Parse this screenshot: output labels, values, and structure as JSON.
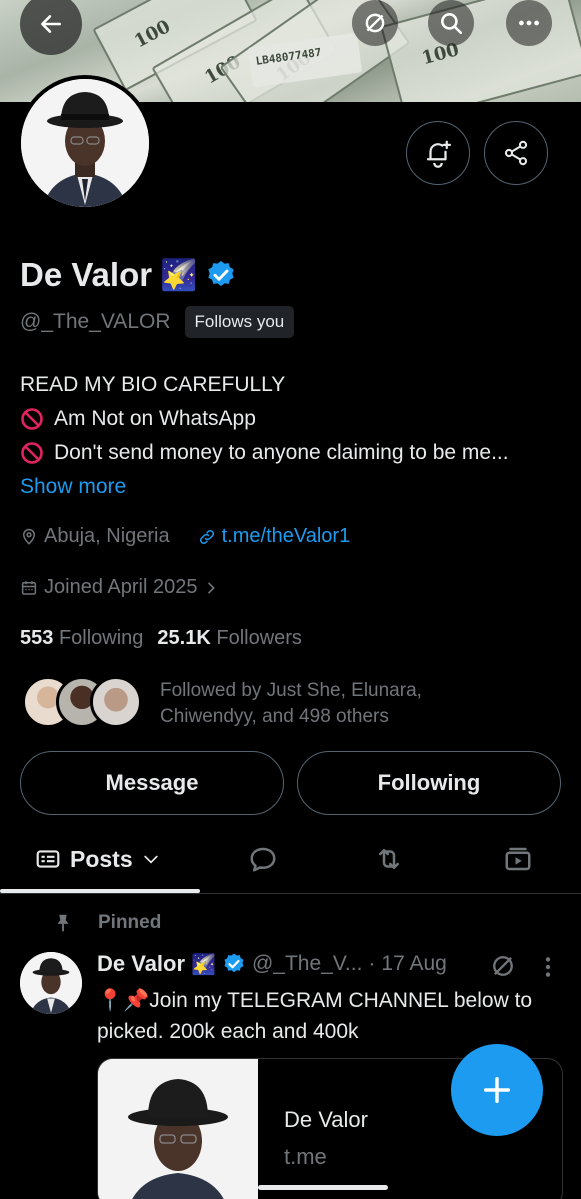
{
  "banner": {
    "bill_text": [
      "100",
      "100",
      "100",
      "LB48077487",
      "100"
    ]
  },
  "profile": {
    "display_name": "De Valor",
    "emoji": "🌠",
    "handle": "@_The_VALOR",
    "follows_you": "Follows you",
    "bio_lines": [
      "READ MY BIO CAREFULLY",
      "Am Not on WhatsApp",
      "Don't send money to anyone claiming to be me..."
    ],
    "show_more": "Show more",
    "location": "Abuja, Nigeria",
    "link": "t.me/theValor1",
    "joined": "Joined April 2025",
    "following_count": "553",
    "following_label": "Following",
    "followers_count": "25.1K",
    "followers_label": "Followers",
    "followed_by": "Followed by Just She, Elunara, Chiwendyy, and 498 others"
  },
  "actions": {
    "message": "Message",
    "following": "Following"
  },
  "tabs": {
    "posts": "Posts"
  },
  "post": {
    "pinned_label": "Pinned",
    "author": "De Valor",
    "emoji": "🌠",
    "handle": "@_The_V...",
    "separator": "·",
    "date": "17 Aug",
    "text": "📍📌Join my TELEGRAM CHANNEL below to picked. 200k each and 400k",
    "card_title": "De Valor",
    "card_domain": "t.me"
  },
  "colors": {
    "accent": "#1d9bf0",
    "background": "#000000",
    "muted": "#71767b",
    "text": "#e7e9ea",
    "border": "#536471"
  },
  "icons": [
    "back-arrow-icon",
    "grok-icon",
    "search-icon",
    "more-icon",
    "notification-bell-icon",
    "share-icon",
    "verified-badge-icon",
    "location-pin-icon",
    "link-icon",
    "calendar-icon",
    "chevron-right-icon",
    "posts-feed-icon",
    "chevron-down-icon",
    "replies-icon",
    "reposts-icon",
    "media-icon",
    "pin-icon",
    "compose-plus-icon"
  ]
}
